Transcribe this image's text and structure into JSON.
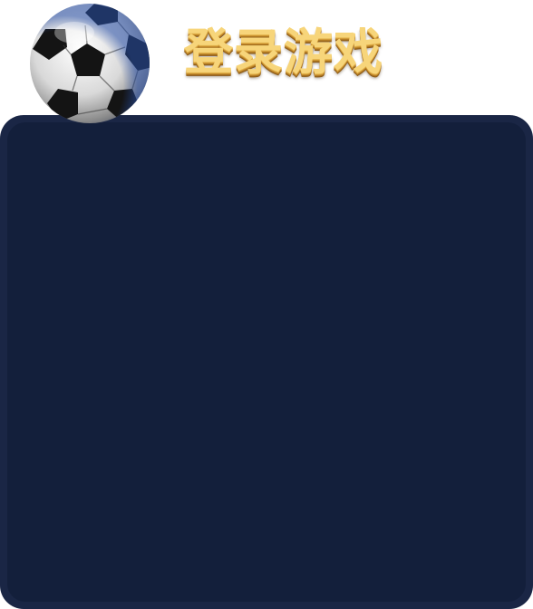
{
  "header": {
    "title": "登录游戏",
    "ball_icon": "soccer-ball-icon"
  },
  "colors": {
    "title_gold": "#f7d57a",
    "title_shadow": "#a8721f",
    "panel_border": "#1a2645",
    "panel_fill": "#131f3b",
    "background": "#ffffff"
  }
}
